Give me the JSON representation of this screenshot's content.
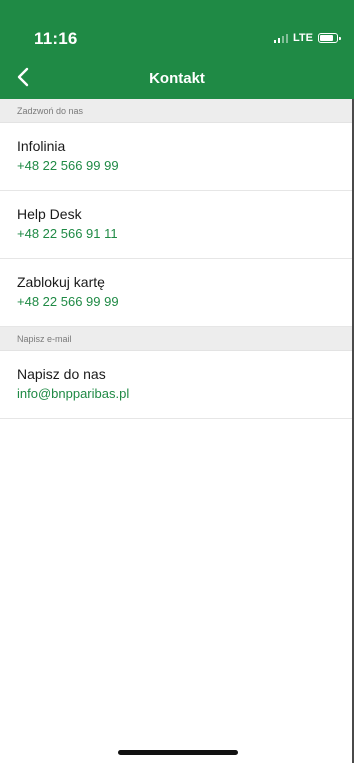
{
  "status_bar": {
    "time": "11:16",
    "network": "LTE",
    "signal_bars_active": 2,
    "signal_bars_total": 4,
    "battery_level": 0.8
  },
  "nav": {
    "title": "Kontakt",
    "back_icon": "chevron-left-icon"
  },
  "sections": {
    "phone": {
      "header": "Zadzwoń do nas",
      "items": [
        {
          "title": "Infolinia",
          "value": "+48 22 566 99 99"
        },
        {
          "title": "Help Desk",
          "value": "+48 22 566 91 11"
        },
        {
          "title": "Zablokuj kartę",
          "value": "+48 22 566 99 99"
        }
      ]
    },
    "email": {
      "header": "Napisz e-mail",
      "items": [
        {
          "title": "Napisz do nas",
          "value": "info@bnpparibas.pl"
        }
      ]
    }
  },
  "colors": {
    "brand_green": "#1f8a45",
    "section_bg": "#ededed",
    "text_dark": "#1a1a1a"
  }
}
